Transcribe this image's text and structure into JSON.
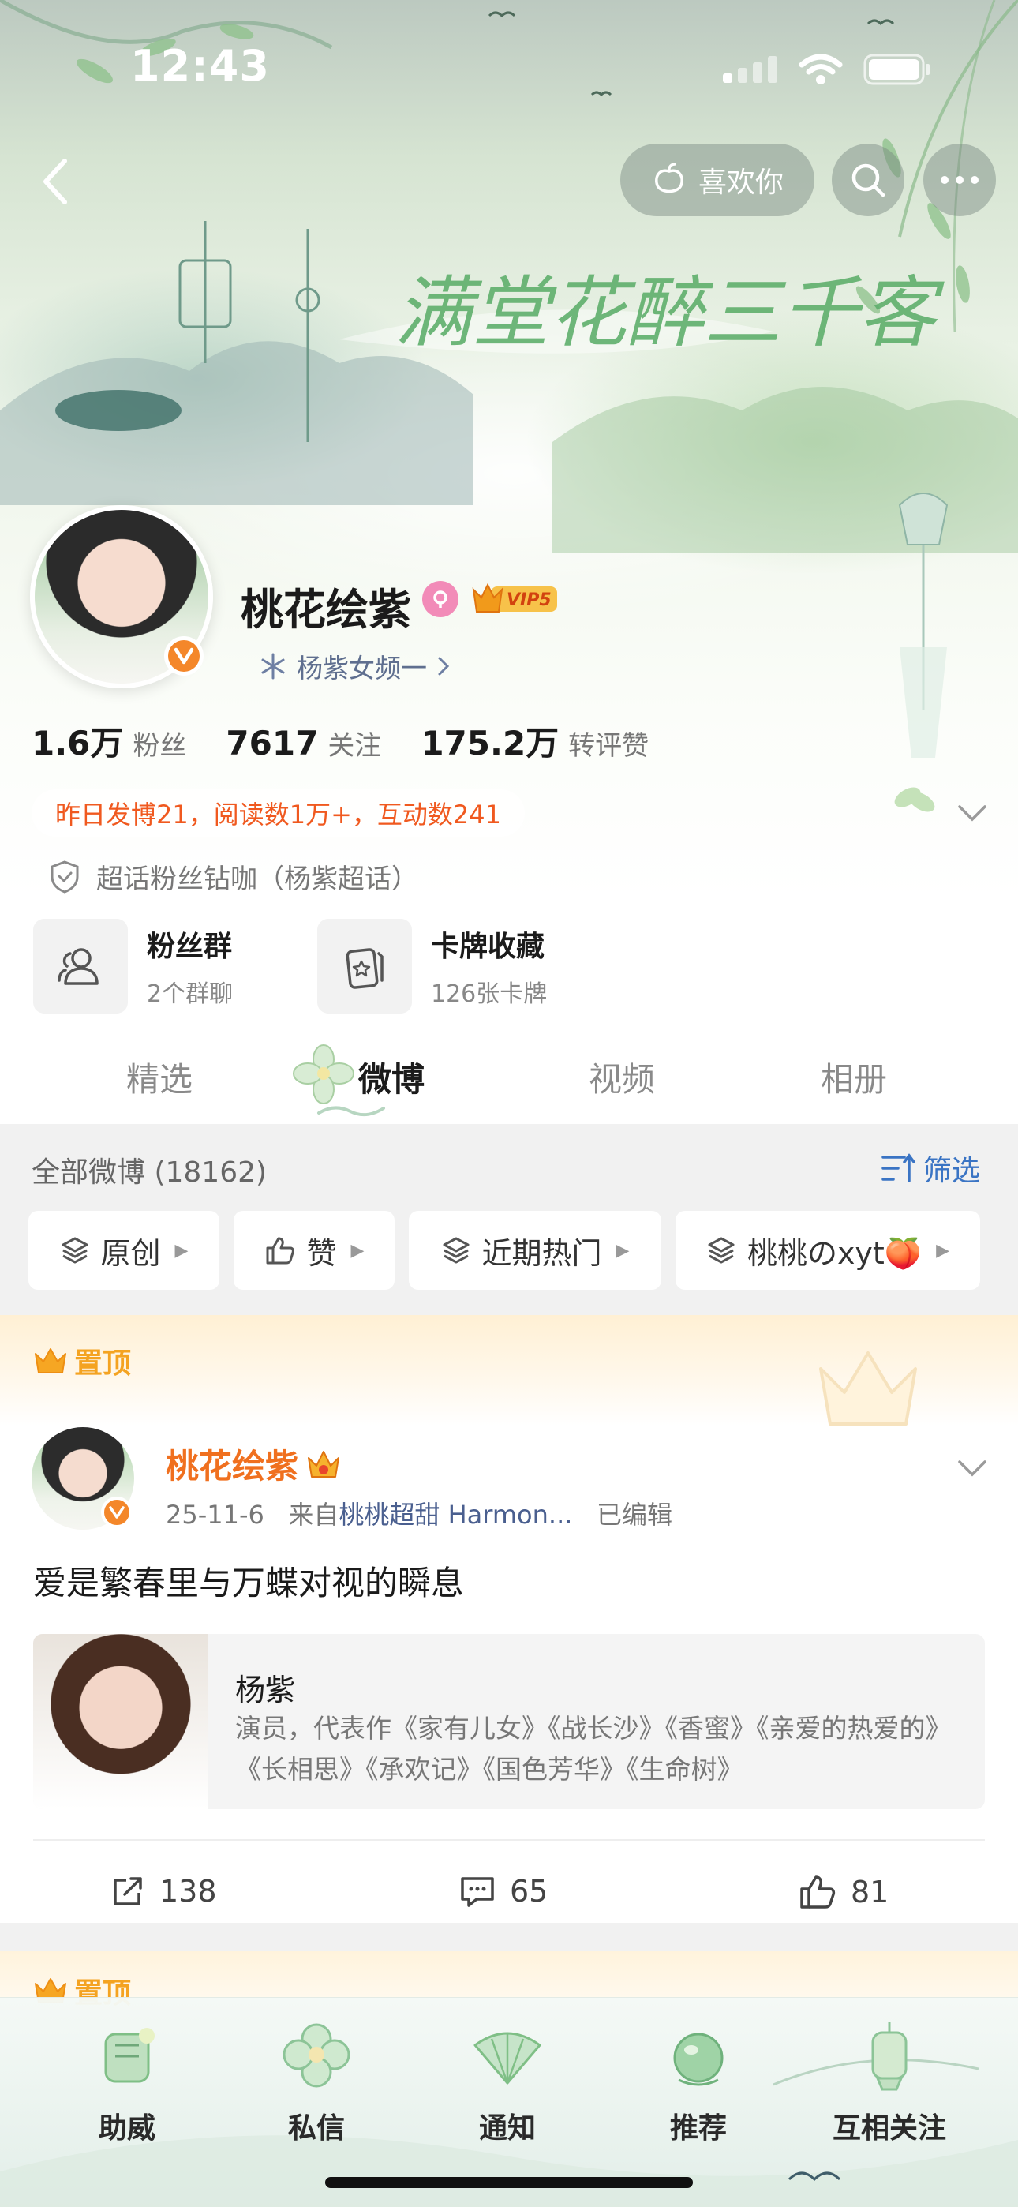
{
  "status_bar": {
    "time": "12:43"
  },
  "top_nav": {
    "like_label": "喜欢你"
  },
  "banner": {
    "calligraphy": "满堂花醉三千客"
  },
  "profile": {
    "username": "桃花绘紫",
    "vip_label": "VIP5",
    "group_label": "杨紫女频一",
    "stats": [
      {
        "value": "1.6万",
        "label": "粉丝"
      },
      {
        "value": "7617",
        "label": "关注"
      },
      {
        "value": "175.2万",
        "label": "转评赞"
      }
    ],
    "activity": "昨日发博21，阅读数1万+，互动数241",
    "super_topic": "超话粉丝钻咖（杨紫超话）",
    "features": [
      {
        "title": "粉丝群",
        "subtitle": "2个群聊"
      },
      {
        "title": "卡牌收藏",
        "subtitle": "126张卡牌"
      }
    ]
  },
  "tabs": [
    {
      "label": "精选",
      "active": false
    },
    {
      "label": "微博",
      "active": true
    },
    {
      "label": "视频",
      "active": false
    },
    {
      "label": "相册",
      "active": false
    }
  ],
  "feed": {
    "header": "全部微博 (18162)",
    "filter_label": "筛选",
    "chips": [
      {
        "label": "原创",
        "icon": "layers-icon"
      },
      {
        "label": "赞",
        "icon": "thumbs-up-icon"
      },
      {
        "label": "近期热门",
        "icon": "layers-icon"
      },
      {
        "label": "桃桃のxyt🍑",
        "icon": "layers-icon"
      }
    ],
    "pinned_label": "置顶",
    "post": {
      "author": "桃花绘紫",
      "date": "25-11-6",
      "from_prefix": "来自",
      "source": "桃桃超甜 Harmon...",
      "edited": "已编辑",
      "text": "爱是繁春里与万蝶对视的瞬息",
      "link_card": {
        "title": "杨紫",
        "description": "演员，代表作《家有儿女》《战长沙》《香蜜》《亲爱的热爱的》《长相思》《承欢记》《国色芳华》《生命树》"
      },
      "reposts": "138",
      "comments": "65",
      "likes": "81"
    },
    "pinned_label_2": "置顶"
  },
  "bottom_bar": [
    {
      "label": "助威"
    },
    {
      "label": "私信"
    },
    {
      "label": "通知"
    },
    {
      "label": "推荐"
    },
    {
      "label": "互相关注"
    }
  ],
  "colors": {
    "accent_orange": "#f0591f",
    "link_blue": "#3a74c4",
    "pin_gold": "#f4a321",
    "verified_orange": "#f4872a"
  }
}
